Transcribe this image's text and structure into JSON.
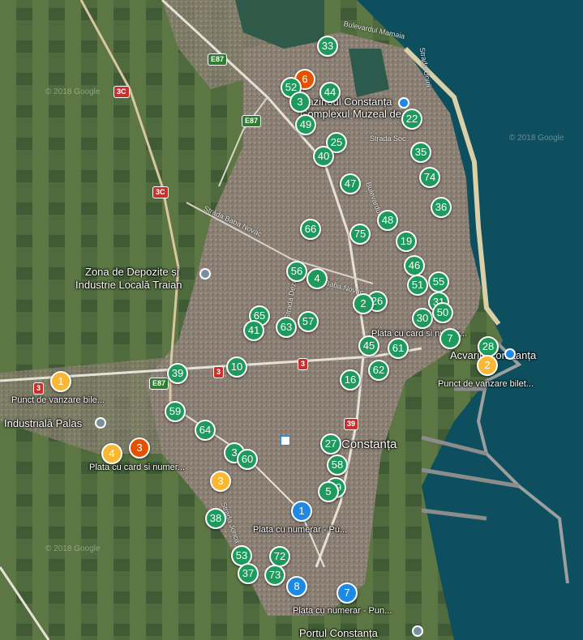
{
  "colors": {
    "green": "#1e9a5c",
    "blue": "#1e88e5",
    "orange": "#e65100",
    "yellow": "#f9b833",
    "sea": "#0d4f5e"
  },
  "places": {
    "zona": "Zona de Depozite și",
    "zona2": "Industrie Locală Traian",
    "industriala": "Industrială Palas",
    "acvariu": "Acvariu Constanța",
    "constanta": "Constanța",
    "portul": "Portul Constanța",
    "cazinoul": "Cazinoul Constanța",
    "complexul": "Complexul Muzeal de..."
  },
  "roads": {
    "mamaia": "Bulevardul Mamaia",
    "unirii": "Strada Unirii",
    "baba": "Strada Baba Novac",
    "socola": "Strada Soc",
    "novac": "Baba Novac",
    "dezrob": "Strada Dezrob",
    "ionescu": "Strada Jonca",
    "bulevard": "Bulevardul"
  },
  "shields": {
    "e87a": "E87",
    "e87b": "E87",
    "e87c": "E87",
    "r3c1": "3C",
    "r3c2": "3C",
    "r3a": "3",
    "r3b": "3",
    "r3c": "3",
    "r39": "39"
  },
  "labels": {
    "l1": "Punct de vanzare bile...",
    "l2": "Punct de vanzare bilet...",
    "l3": "Plata cu card si numer...",
    "l4": "Plata cu card si numer...",
    "l5": "Plata cu numerar - Pu...",
    "l6": "Plata cu numerar - Pun..."
  },
  "watermarks": {
    "w1": "© 2018 Google",
    "w2": "© 2018 Google",
    "w3": "© 2018 Google"
  },
  "markers": [
    {
      "label": "33",
      "color": "green"
    },
    {
      "label": "6",
      "color": "orange"
    },
    {
      "label": "52",
      "color": "green"
    },
    {
      "label": "44",
      "color": "green"
    },
    {
      "label": "3",
      "color": "green"
    },
    {
      "label": "49",
      "color": "green"
    },
    {
      "label": "22",
      "color": "green"
    },
    {
      "label": "25",
      "color": "green"
    },
    {
      "label": "40",
      "color": "green"
    },
    {
      "label": "35",
      "color": "green"
    },
    {
      "label": "74",
      "color": "green"
    },
    {
      "label": "47",
      "color": "green"
    },
    {
      "label": "36",
      "color": "green"
    },
    {
      "label": "48",
      "color": "green"
    },
    {
      "label": "66",
      "color": "green"
    },
    {
      "label": "75",
      "color": "green"
    },
    {
      "label": "19",
      "color": "green"
    },
    {
      "label": "56",
      "color": "green"
    },
    {
      "label": "4",
      "color": "green"
    },
    {
      "label": "46",
      "color": "green"
    },
    {
      "label": "55",
      "color": "green"
    },
    {
      "label": "51",
      "color": "green"
    },
    {
      "label": "26",
      "color": "green"
    },
    {
      "label": "2",
      "color": "green"
    },
    {
      "label": "31",
      "color": "green"
    },
    {
      "label": "30",
      "color": "green"
    },
    {
      "label": "50",
      "color": "green"
    },
    {
      "label": "65",
      "color": "green"
    },
    {
      "label": "63",
      "color": "green"
    },
    {
      "label": "57",
      "color": "green"
    },
    {
      "label": "41",
      "color": "green"
    },
    {
      "label": "45",
      "color": "green"
    },
    {
      "label": "61",
      "color": "green"
    },
    {
      "label": "7",
      "color": "green"
    },
    {
      "label": "28",
      "color": "green"
    },
    {
      "label": "2",
      "color": "yellow"
    },
    {
      "label": "62",
      "color": "green"
    },
    {
      "label": "16",
      "color": "green"
    },
    {
      "label": "39",
      "color": "green"
    },
    {
      "label": "10",
      "color": "green"
    },
    {
      "label": "1",
      "color": "yellow"
    },
    {
      "label": "59",
      "color": "green"
    },
    {
      "label": "64",
      "color": "green"
    },
    {
      "label": "4",
      "color": "yellow"
    },
    {
      "label": "3",
      "color": "orange"
    },
    {
      "label": "3",
      "color": "green"
    },
    {
      "label": "60",
      "color": "green"
    },
    {
      "label": "27",
      "color": "green"
    },
    {
      "label": "58",
      "color": "green"
    },
    {
      "label": "3",
      "color": "yellow"
    },
    {
      "label": "69",
      "color": "green"
    },
    {
      "label": "5",
      "color": "green"
    },
    {
      "label": "1",
      "color": "blue"
    },
    {
      "label": "38",
      "color": "green"
    },
    {
      "label": "53",
      "color": "green"
    },
    {
      "label": "72",
      "color": "green"
    },
    {
      "label": "37",
      "color": "green"
    },
    {
      "label": "73",
      "color": "green"
    },
    {
      "label": "8",
      "color": "blue"
    },
    {
      "label": "7",
      "color": "blue"
    }
  ]
}
